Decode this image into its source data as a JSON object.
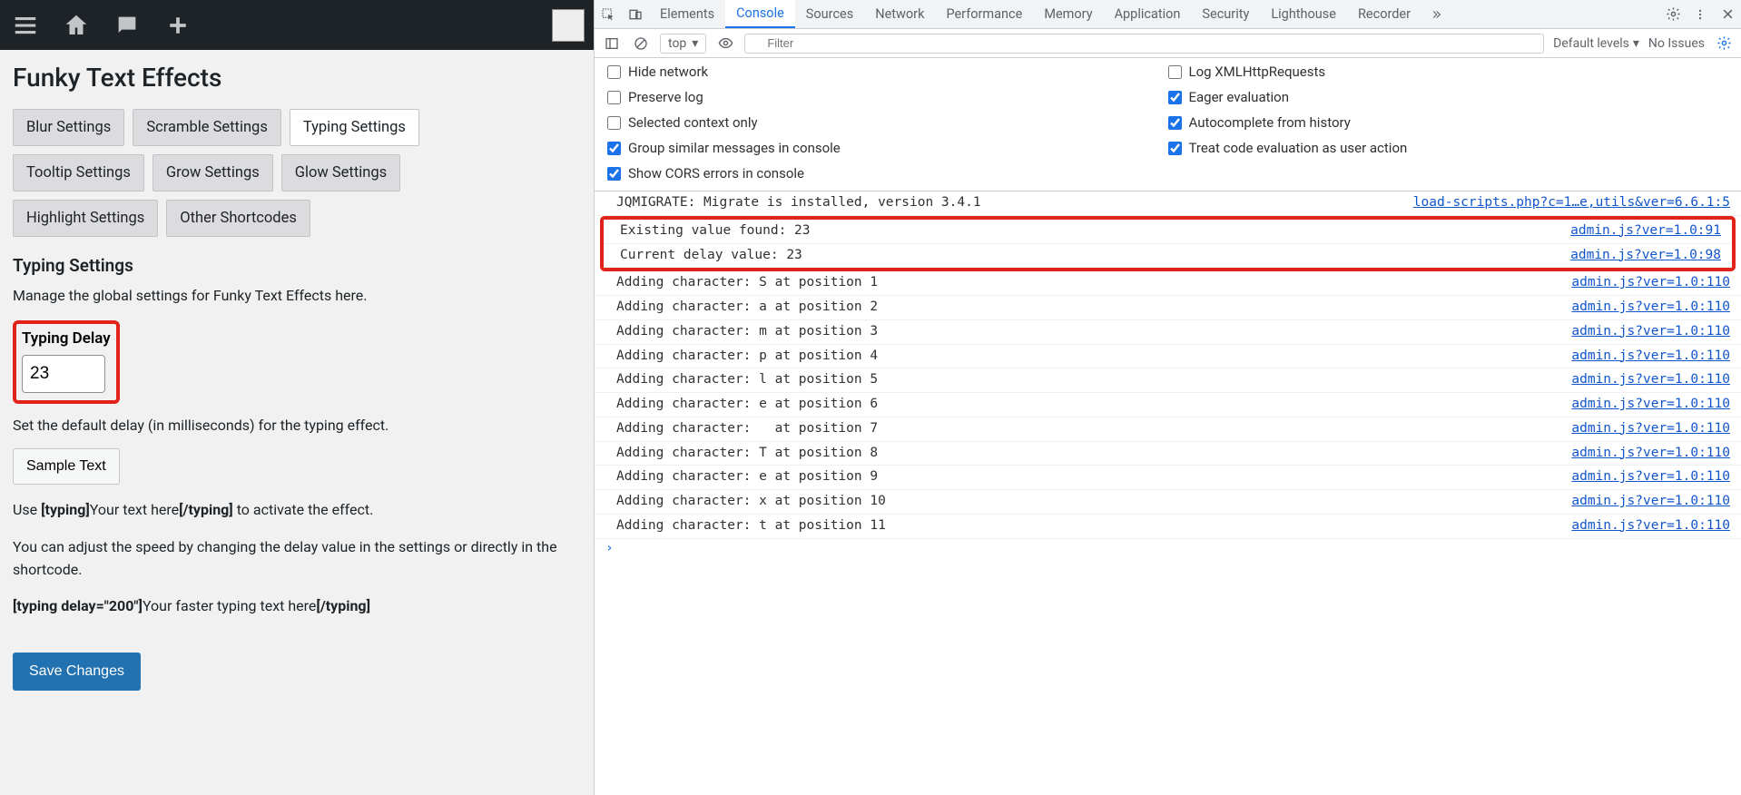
{
  "wp": {
    "page_title": "Funky Text Effects",
    "tabs": [
      {
        "label": "Blur Settings",
        "active": false
      },
      {
        "label": "Scramble Settings",
        "active": false
      },
      {
        "label": "Typing Settings",
        "active": true
      },
      {
        "label": "Tooltip Settings",
        "active": false
      },
      {
        "label": "Grow Settings",
        "active": false
      },
      {
        "label": "Glow Settings",
        "active": false
      },
      {
        "label": "Highlight Settings",
        "active": false
      },
      {
        "label": "Other Shortcodes",
        "active": false
      }
    ],
    "section_title": "Typing Settings",
    "section_desc": "Manage the global settings for Funky Text Effects here.",
    "field_label": "Typing Delay",
    "field_value": "23",
    "field_help": "Set the default delay (in milliseconds) for the typing effect.",
    "sample_btn": "Sample Text",
    "usage_prefix": "Use ",
    "usage_open": "[typing]",
    "usage_mid": "Your text here",
    "usage_close": "[/typing]",
    "usage_suffix": " to activate the effect.",
    "adjust_text": "You can adjust the speed by changing the delay value in the settings or directly in the shortcode.",
    "ex_open": "[typing delay=\"200\"]",
    "ex_mid": "Your faster typing text here",
    "ex_close": "[/typing]",
    "save_btn": "Save Changes"
  },
  "devtools": {
    "tabs": [
      "Elements",
      "Console",
      "Sources",
      "Network",
      "Performance",
      "Memory",
      "Application",
      "Security",
      "Lighthouse",
      "Recorder"
    ],
    "active_tab": "Console",
    "context": "top",
    "filter_placeholder": "Filter",
    "levels": "Default levels",
    "issues": "No Issues",
    "settings": [
      {
        "label": "Hide network",
        "checked": false
      },
      {
        "label": "Log XMLHttpRequests",
        "checked": false
      },
      {
        "label": "Preserve log",
        "checked": false
      },
      {
        "label": "Eager evaluation",
        "checked": true
      },
      {
        "label": "Selected context only",
        "checked": false
      },
      {
        "label": "Autocomplete from history",
        "checked": true
      },
      {
        "label": "Group similar messages in console",
        "checked": true
      },
      {
        "label": "Treat code evaluation as user action",
        "checked": true
      },
      {
        "label": "Show CORS errors in console",
        "checked": true
      }
    ],
    "first_log": {
      "msg": "JQMIGRATE: Migrate is installed, version 3.4.1",
      "src": "load-scripts.php?c=1…e,utils&ver=6.6.1:5"
    },
    "highlighted": [
      {
        "msg": "Existing value found: 23",
        "src": "admin.js?ver=1.0:91"
      },
      {
        "msg": "Current delay value: 23",
        "src": "admin.js?ver=1.0:98"
      }
    ],
    "logs": [
      {
        "msg": "Adding character: S at position 1",
        "src": "admin.js?ver=1.0:110"
      },
      {
        "msg": "Adding character: a at position 2",
        "src": "admin.js?ver=1.0:110"
      },
      {
        "msg": "Adding character: m at position 3",
        "src": "admin.js?ver=1.0:110"
      },
      {
        "msg": "Adding character: p at position 4",
        "src": "admin.js?ver=1.0:110"
      },
      {
        "msg": "Adding character: l at position 5",
        "src": "admin.js?ver=1.0:110"
      },
      {
        "msg": "Adding character: e at position 6",
        "src": "admin.js?ver=1.0:110"
      },
      {
        "msg": "Adding character:   at position 7",
        "src": "admin.js?ver=1.0:110"
      },
      {
        "msg": "Adding character: T at position 8",
        "src": "admin.js?ver=1.0:110"
      },
      {
        "msg": "Adding character: e at position 9",
        "src": "admin.js?ver=1.0:110"
      },
      {
        "msg": "Adding character: x at position 10",
        "src": "admin.js?ver=1.0:110"
      },
      {
        "msg": "Adding character: t at position 11",
        "src": "admin.js?ver=1.0:110"
      }
    ]
  }
}
